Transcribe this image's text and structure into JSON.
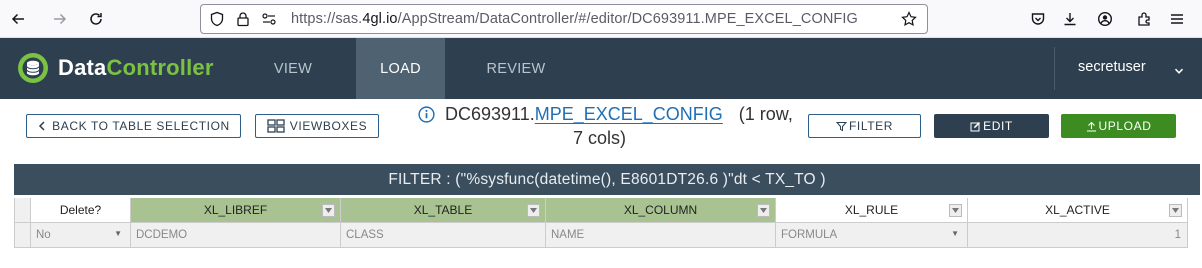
{
  "browser": {
    "url_prefix": "https://sas.",
    "url_domain": "4gl.io",
    "url_path": "/AppStream/DataController/#/editor/DC693911.MPE_EXCEL_CONFIG"
  },
  "header": {
    "logo_part1": "Data",
    "logo_part2": "Controller",
    "tabs": [
      {
        "label": "VIEW"
      },
      {
        "label": "LOAD"
      },
      {
        "label": "REVIEW"
      }
    ],
    "username": "secretuser"
  },
  "toolbar": {
    "back_label": "BACK TO TABLE SELECTION",
    "viewboxes_label": "VIEWBOXES",
    "lib_prefix": "DC693911.",
    "table_name": "MPE_EXCEL_CONFIG",
    "rows_text": "(1 row,",
    "cols_text": "7 cols)",
    "filter_label": "FILTER",
    "edit_label": "EDIT",
    "upload_label": "UPLOAD"
  },
  "filter_banner": "FILTER : (\"%sysfunc(datetime(), E8601DT26.6 )\"dt < TX_TO )",
  "grid": {
    "columns": [
      "Delete?",
      "XL_LIBREF",
      "XL_TABLE",
      "XL_COLUMN",
      "XL_RULE",
      "XL_ACTIVE"
    ],
    "row": [
      "No",
      "DCDEMO",
      "CLASS",
      "NAME",
      "FORMULA",
      "1"
    ]
  },
  "colors": {
    "header_bg": "#2e4050",
    "active_tab": "#4f6272",
    "brand_green": "#7cc242",
    "upload_green": "#3c8c22",
    "pk_column": "#a8c391",
    "link_blue": "#1f6fb5"
  }
}
